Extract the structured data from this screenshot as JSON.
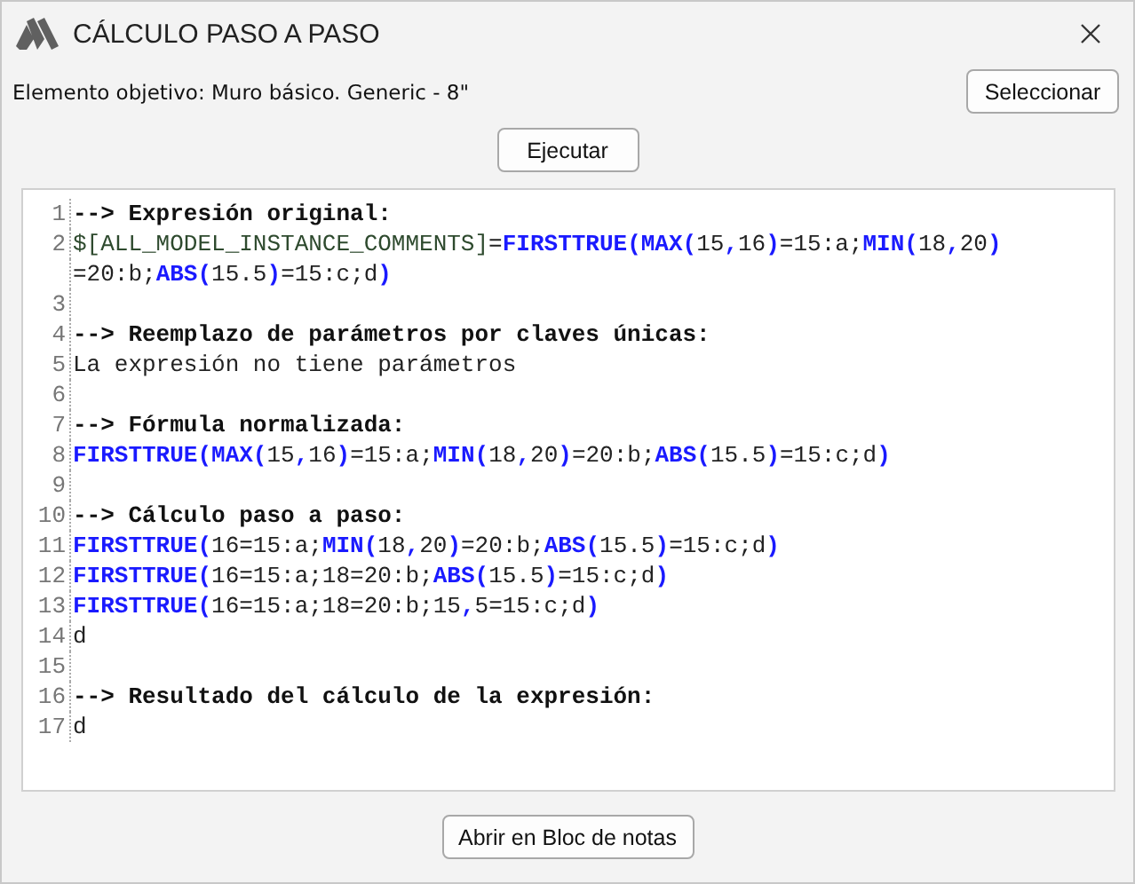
{
  "window": {
    "title": "CÁLCULO PASO A PASO"
  },
  "target_label": "Elemento objetivo: Muro básico. Generic - 8\"",
  "select_button": "Seleccionar",
  "run_button": "Ejecutar",
  "code_lines": [
    {
      "number": "1",
      "segments": [
        {
          "kind": "heading",
          "text": "--> Expresión original:"
        }
      ]
    },
    {
      "number": "2",
      "segments": [
        {
          "kind": "variable",
          "text": "$[ALL_MODEL_INSTANCE_COMMENTS]"
        },
        {
          "kind": "plain",
          "text": "="
        },
        {
          "kind": "function",
          "text": "FIRSTTRUE(MAX("
        },
        {
          "kind": "plain",
          "text": "15"
        },
        {
          "kind": "function",
          "text": ","
        },
        {
          "kind": "plain",
          "text": "16"
        },
        {
          "kind": "function",
          "text": ")"
        },
        {
          "kind": "plain",
          "text": "=15:a;"
        },
        {
          "kind": "function",
          "text": "MIN("
        },
        {
          "kind": "plain",
          "text": "18"
        },
        {
          "kind": "function",
          "text": ","
        },
        {
          "kind": "plain",
          "text": "20"
        },
        {
          "kind": "function",
          "text": ")"
        }
      ]
    },
    {
      "segments": [
        {
          "kind": "plain",
          "text": "=20:b;"
        },
        {
          "kind": "function",
          "text": "ABS("
        },
        {
          "kind": "plain",
          "text": "15.5"
        },
        {
          "kind": "function",
          "text": ")"
        },
        {
          "kind": "plain",
          "text": "=15:c;d"
        },
        {
          "kind": "function",
          "text": ")"
        }
      ]
    },
    {
      "number": "3"
    },
    {
      "number": "4",
      "segments": [
        {
          "kind": "heading",
          "text": "--> Reemplazo de parámetros por claves únicas:"
        }
      ]
    },
    {
      "number": "5",
      "segments": [
        {
          "kind": "plain",
          "text": "La expresión no tiene parámetros"
        }
      ]
    },
    {
      "number": "6"
    },
    {
      "number": "7",
      "segments": [
        {
          "kind": "heading",
          "text": "--> Fórmula normalizada:"
        }
      ]
    },
    {
      "number": "8",
      "segments": [
        {
          "kind": "function",
          "text": "FIRSTTRUE(MAX("
        },
        {
          "kind": "plain",
          "text": "15"
        },
        {
          "kind": "function",
          "text": ","
        },
        {
          "kind": "plain",
          "text": "16"
        },
        {
          "kind": "function",
          "text": ")"
        },
        {
          "kind": "plain",
          "text": "=15:a;"
        },
        {
          "kind": "function",
          "text": "MIN("
        },
        {
          "kind": "plain",
          "text": "18"
        },
        {
          "kind": "function",
          "text": ","
        },
        {
          "kind": "plain",
          "text": "20"
        },
        {
          "kind": "function",
          "text": ")"
        },
        {
          "kind": "plain",
          "text": "=20:b;"
        },
        {
          "kind": "function",
          "text": "ABS("
        },
        {
          "kind": "plain",
          "text": "15.5"
        },
        {
          "kind": "function",
          "text": ")"
        },
        {
          "kind": "plain",
          "text": "=15:c;d"
        },
        {
          "kind": "function",
          "text": ")"
        }
      ]
    },
    {
      "number": "9"
    },
    {
      "number": "10",
      "segments": [
        {
          "kind": "heading",
          "text": "--> Cálculo paso a paso:"
        }
      ]
    },
    {
      "number": "11",
      "segments": [
        {
          "kind": "function",
          "text": "FIRSTTRUE("
        },
        {
          "kind": "plain",
          "text": "16=15:a;"
        },
        {
          "kind": "function",
          "text": "MIN("
        },
        {
          "kind": "plain",
          "text": "18"
        },
        {
          "kind": "function",
          "text": ","
        },
        {
          "kind": "plain",
          "text": "20"
        },
        {
          "kind": "function",
          "text": ")"
        },
        {
          "kind": "plain",
          "text": "=20:b;"
        },
        {
          "kind": "function",
          "text": "ABS("
        },
        {
          "kind": "plain",
          "text": "15.5"
        },
        {
          "kind": "function",
          "text": ")"
        },
        {
          "kind": "plain",
          "text": "=15:c;d"
        },
        {
          "kind": "function",
          "text": ")"
        }
      ]
    },
    {
      "number": "12",
      "segments": [
        {
          "kind": "function",
          "text": "FIRSTTRUE("
        },
        {
          "kind": "plain",
          "text": "16=15:a;18=20:b;"
        },
        {
          "kind": "function",
          "text": "ABS("
        },
        {
          "kind": "plain",
          "text": "15.5"
        },
        {
          "kind": "function",
          "text": ")"
        },
        {
          "kind": "plain",
          "text": "=15:c;d"
        },
        {
          "kind": "function",
          "text": ")"
        }
      ]
    },
    {
      "number": "13",
      "segments": [
        {
          "kind": "function",
          "text": "FIRSTTRUE("
        },
        {
          "kind": "plain",
          "text": "16=15:a;18=20:b;15"
        },
        {
          "kind": "function",
          "text": ","
        },
        {
          "kind": "plain",
          "text": "5=15:c;d"
        },
        {
          "kind": "function",
          "text": ")"
        }
      ]
    },
    {
      "number": "14",
      "segments": [
        {
          "kind": "plain",
          "text": "d"
        }
      ]
    },
    {
      "number": "15"
    },
    {
      "number": "16",
      "segments": [
        {
          "kind": "heading",
          "text": "--> Resultado del cálculo de la expresión:"
        }
      ]
    },
    {
      "number": "17",
      "segments": [
        {
          "kind": "plain",
          "text": "d"
        }
      ]
    }
  ],
  "notepad_button": "Abrir en Bloc de notas"
}
